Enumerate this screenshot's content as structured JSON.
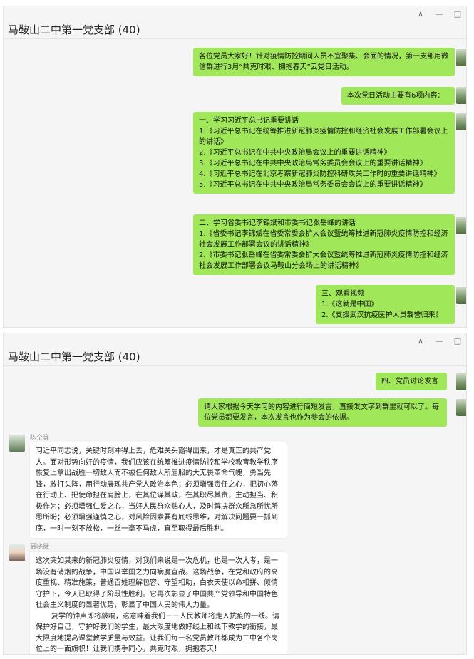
{
  "window": {
    "title": "马鞍山二中第一党支部 (40)",
    "pin_icon": "pin-icon",
    "min_icon": "minimize-icon",
    "max_icon": "maximize-icon",
    "pin_glyph": "⊼",
    "min_glyph": "—",
    "max_glyph": "□"
  },
  "panel1": {
    "messages": [
      "各位党员大家好！针对疫情防控期间人员不宜聚集、会面的情况，第一支部用微信群进行3月“共克时艰、拥抱春天”云党日活动。",
      "本次党日活动主要有6项内容：",
      "一、学习习近平总书记重要讲话\n1.《习近平总书记在统筹推进新冠肺炎疫情防控和经济社会发展工作部署会议上的讲话》\n2.《习近平总书记在中共中央政治局会议上的重要讲话精神》\n3.《习近平总书记在中共中央政治局常务委员会会议上的重要讲话精神》\n4.《习近平总书记在北京考察新冠肺炎防控科研攻关工作时的重要讲话精神》\n5.《习近平总书记在中共中央政治局常务委员会会议上的重要讲话精神》",
      "二、学习省委书记李锦斌和市委书记张岳峰的讲话\n1.《省委书记李锦斌在省委常委会扩大会议暨统筹推进新冠肺炎疫情防控和经济社会发展工作部署会议的讲话精神》\n2.《市委书记张岳峰在省委常委会扩大会议暨统筹推进新冠肺炎疫情防控和经济社会发展工作部署会议马鞍山分会场上的讲话精神》",
      "三、观看视频\n1.《这就是中国》\n2.《支援武汉抗疫医护人员载誉归来》"
    ]
  },
  "panel2": {
    "messages": [
      "四、党员讨论发言",
      "请大家根据今天学习的内容进行简短发言，直接发文字到群里就可以了。每位党员都要发言，本次发言也作为参会的依据。"
    ],
    "replies": [
      {
        "sender": "陈仝等",
        "text": "习近平同志说，关键时刻冲得上去，危难关头豁得出来，才是真正的共产党人。面对形势向好的疫情，我们应该在统筹推进疫情防控和学校教育教学秩序恢复上拿出战胜一切敌人而不被任何敌人所屈服的大无畏革命气魄，勇当先锋，敢打头阵，用行动展现共产党人政治本色；必须增强责任之心，把初心落在行动上、把使命担在肩膀上，在其位谋其政，在其职尽其责，主动担当、积极作为；必须增强仁爱之心，当好人民群众贴心人，及时解决群众所急所忧所思所盼；必须增强谨慎之心，对风险因素要有底线思维，对解决问题要一抓到底，一时一刻不放松，一丝一毫不马虎，直至取得最后胜利。"
      },
      {
        "sender": "聂晓薇",
        "text1": "这次突如其来的新冠肺炎疫情，对我们来说是一次危机，也是一次大考，是一场没有硝烟的战争，中国以举国之力向病魔宣战。这场战争，在党和政府的高度重视、精准施策，普通百姓理解包容、守望相助，白衣天使以命相拼、倾情守护下，今天已取得了阶段性胜利。它再次彰显了中国共产党领导和中国特色社会主义制度的显著优势，彰显了中国人民的伟大力量。",
        "text2": "复学的钟声即将敲响，这意味着我们－－人民教师将走入抗疫的一线。请保护好自己，守护好我们的学生，最大限度地做好线上和线下教学的衔接，最大限度地提高课堂教学质量与效益。让我们每一名党员教师都成为二中各个岗位上的一面旗帜！让我们携手同心，共克时艰，拥抱春天！"
      }
    ]
  }
}
